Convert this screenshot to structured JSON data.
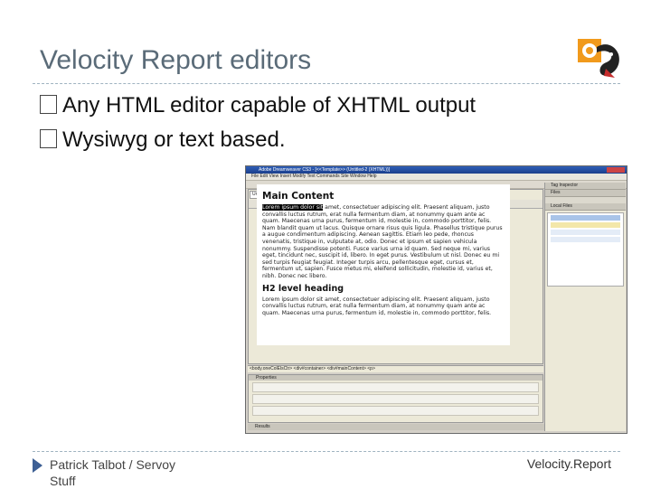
{
  "slide": {
    "title": "Velocity Report editors",
    "bullets": [
      "Any HTML editor capable of XHTML output",
      "Wysiwyg or text based."
    ],
    "footer_left": "Patrick Talbot / Servoy Stuff",
    "footer_right": "Velocity.Report"
  },
  "editor": {
    "window_title": "Adobe Dreamweaver CS3 - [<<Template>> (Untitled-2 (XHTML))]",
    "menu": "File  Edit  View  Insert  Modify  Text  Commands  Site  Window  Help",
    "doc_tab": "Untitled-2",
    "heading_main": "Main Content",
    "para1_highlight": "Lorem ipsum dolor sit",
    "para1_rest": " amet, consectetuer adipiscing elit. Praesent aliquam, justo convallis luctus rutrum, erat nulla fermentum diam, at nonummy quam ante ac quam. Maecenas urna purus, fermentum id, molestie in, commodo porttitor, felis. Nam blandit quam ut lacus. Quisque ornare risus quis ligula. Phasellus tristique purus a augue condimentum adipiscing. Aenean sagittis. Etiam leo pede, rhoncus venenatis, tristique in, vulputate at, odio. Donec et ipsum et sapien vehicula nonummy. Suspendisse potenti. Fusce varius urna id quam. Sed neque mi, varius eget, tincidunt nec, suscipit id, libero. In eget purus. Vestibulum ut nisl. Donec eu mi sed turpis feugiat feugiat. Integer turpis arcu, pellentesque eget, cursus et, fermentum ut, sapien. Fusce metus mi, eleifend sollicitudin, molestie id, varius et, nibh. Donec nec libero.",
    "heading_h2": "H2 level heading",
    "para2": "Lorem ipsum dolor sit amet, consectetuer adipiscing elit. Praesent aliquam, justo convallis luctus rutrum, erat nulla fermentum diam, at nonummy quam ante ac quam. Maecenas urna purus, fermentum id, molestie in, commodo porttitor, felis.",
    "status": "<body.oneColElsCtr> <div#container> <div#mainContent> <p>",
    "properties_label": "Properties",
    "results_label": "Results",
    "files_panel": "Files",
    "tag_panel": "Tag Inspector",
    "local_files": "Local Files"
  }
}
